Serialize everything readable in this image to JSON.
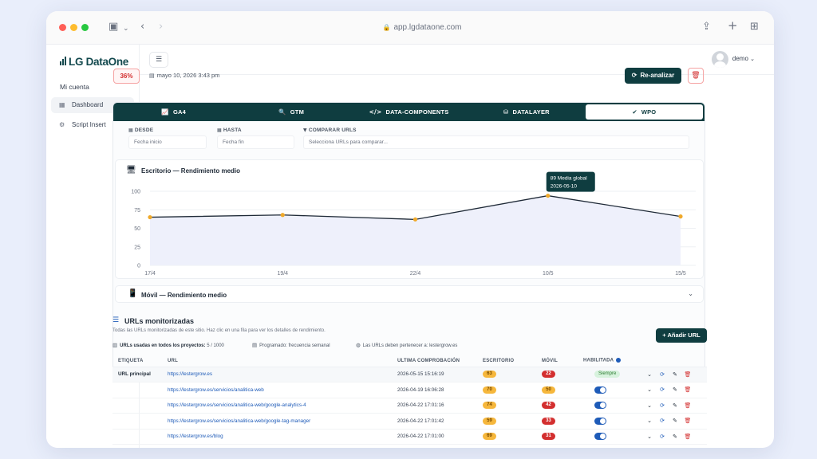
{
  "browser": {
    "address": "app.lgdataone.com",
    "sidebar_toggle_icon": "sidebar-icon",
    "share_icon": "share-icon",
    "new_tab_icon": "plus-icon",
    "tabs_icon": "grid-icon"
  },
  "sidebar": {
    "brand": "LG DataOne",
    "section": "Mi cuenta",
    "items": [
      {
        "label": "Dashboard",
        "icon": "table-icon",
        "active": true
      },
      {
        "label": "Script Insert",
        "icon": "gear-icon",
        "active": false
      }
    ]
  },
  "topbar": {
    "user": "demo"
  },
  "header": {
    "score": "36%",
    "date": "mayo 10, 2026 3:43 pm",
    "reanalyze_label": "Re-analizar"
  },
  "tabs": [
    {
      "label": "GA4",
      "icon": "chart-icon",
      "active": false
    },
    {
      "label": "GTM",
      "icon": "search-icon",
      "active": false
    },
    {
      "label": "DATA-COMPONENTS",
      "icon": "code-icon",
      "active": false
    },
    {
      "label": "DATALAYER",
      "icon": "database-icon",
      "active": false
    },
    {
      "label": "WPO",
      "icon": "check-circle-icon",
      "active": true
    }
  ],
  "filters": {
    "desde_label": "DESDE",
    "desde_placeholder": "Fecha inicio",
    "hasta_label": "HASTA",
    "hasta_placeholder": "Fecha fin",
    "comparar_label": "COMPARAR URLS",
    "comparar_placeholder": "Selecciona URLs para comparar..."
  },
  "chart_data": {
    "type": "line",
    "title": "Escritorio — Rendimiento medio",
    "x": [
      "17/4",
      "19/4",
      "22/4",
      "10/5",
      "15/5"
    ],
    "y": [
      65,
      68,
      62,
      94,
      66
    ],
    "ylim": [
      0,
      100
    ],
    "yticks": [
      0,
      25,
      50,
      75,
      100
    ],
    "grid": true,
    "tooltip": {
      "line1": "89 Media global",
      "line2": "2026-05-10"
    },
    "colors": {
      "line": "#1f2a37",
      "point": "#f0a92a",
      "fill": "#eef0fb"
    }
  },
  "mobile_section": {
    "title": "Móvil — Rendimiento medio"
  },
  "urls": {
    "title": "URLs monitorizadas",
    "description": "Todas las URLs monitorizadas de este sitio. Haz clic en una fila para ver los detalles de rendimiento.",
    "used_label": "URLs usadas en todos los proyectos:",
    "used_value": "5 / 1000",
    "schedule": "Programado: frecuencia semanal",
    "domain_rule": "Las URLs deben pertenecer a:",
    "domain": "lestergrow.es",
    "add_label": "+ Añadir URL",
    "columns": [
      "ETIQUETA",
      "URL",
      "ULTIMA COMPROBACIÓN",
      "ESCRITORIO",
      "MÓVIL",
      "HABILITADA"
    ],
    "rows": [
      {
        "label": "URL principal",
        "url": "https://lestergrow.es",
        "checked": "2026-05-15 15:16:19",
        "desktop": "63",
        "desktop_color": "orange",
        "mobile": "22",
        "mobile_color": "red",
        "enabled": "Siempre"
      },
      {
        "label": "",
        "url": "https://lestergrow.es/servicios/analitica-web",
        "checked": "2026-04-19 16:06:28",
        "desktop": "70",
        "desktop_color": "orange",
        "mobile": "50",
        "mobile_color": "orange",
        "enabled": "toggle"
      },
      {
        "label": "",
        "url": "https://lestergrow.es/servicios/analitica-web/google-analytics-4",
        "checked": "2026-04-22 17:01:16",
        "desktop": "74",
        "desktop_color": "orange",
        "mobile": "42",
        "mobile_color": "red",
        "enabled": "toggle"
      },
      {
        "label": "",
        "url": "https://lestergrow.es/servicios/analitica-web/google-tag-manager",
        "checked": "2026-04-22 17:01:42",
        "desktop": "59",
        "desktop_color": "orange",
        "mobile": "33",
        "mobile_color": "red",
        "enabled": "toggle"
      },
      {
        "label": "",
        "url": "https://lestergrow.es/blog",
        "checked": "2026-04-22 17:01:00",
        "desktop": "69",
        "desktop_color": "orange",
        "mobile": "31",
        "mobile_color": "red",
        "enabled": "toggle"
      }
    ]
  }
}
